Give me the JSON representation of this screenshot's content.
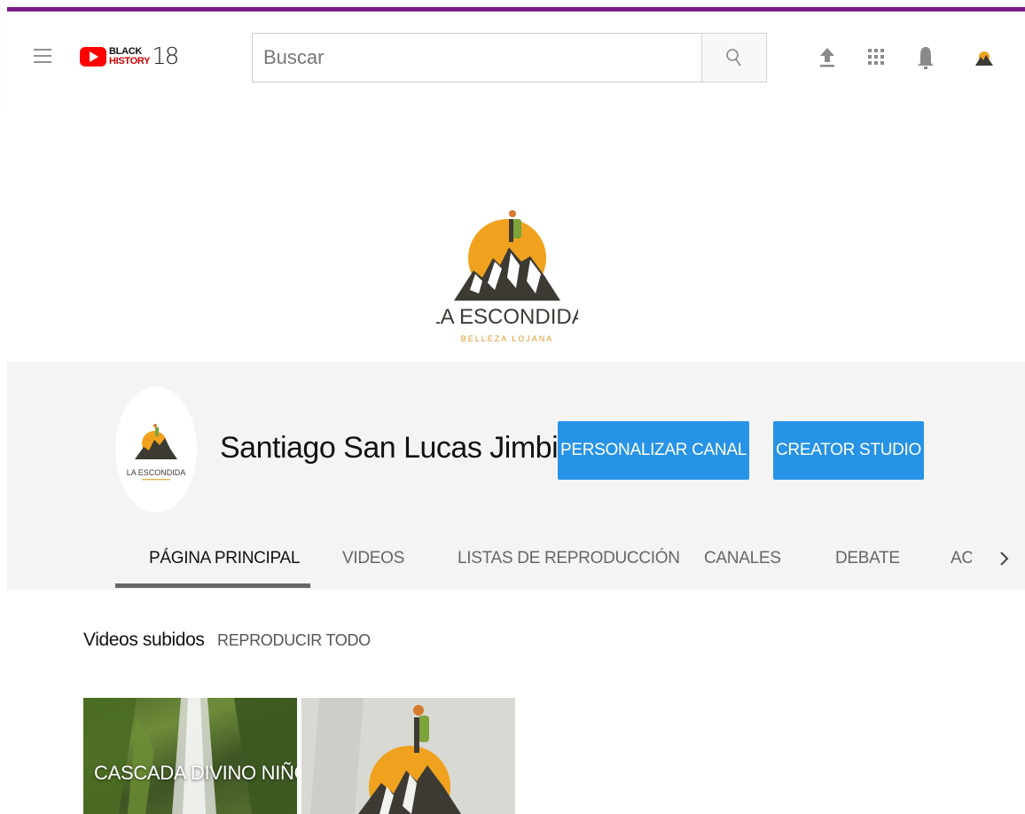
{
  "header": {
    "logo_line1": "BLACK",
    "logo_line2": "HISTORY",
    "logo_year": "18",
    "search_placeholder": "Buscar"
  },
  "banner": {
    "brand_name": "LA ESCONDIDA",
    "brand_tagline": "BELLEZA LOJANA"
  },
  "channel": {
    "name": "Santiago San Lucas Jimbilla",
    "avatar_brand": "LA ESCONDIDA",
    "customize_label": "PERSONALIZAR CANAL",
    "creator_studio_label": "CREATOR STUDIO"
  },
  "tabs": [
    {
      "label": "PÁGINA PRINCIPAL"
    },
    {
      "label": "VIDEOS"
    },
    {
      "label": "LISTAS DE REPRODUCCIÓN"
    },
    {
      "label": "CANALES"
    },
    {
      "label": "DEBATE"
    },
    {
      "label": "ACERCA DE"
    }
  ],
  "uploads": {
    "title": "Videos subidos",
    "play_all_label": "REPRODUCIR TODO",
    "videos": [
      {
        "caption": "CASCADA DIVINO NIÑO"
      },
      {
        "caption": ""
      }
    ]
  },
  "colors": {
    "accent_blue": "#2793e6",
    "top_strip": "#7b1b86",
    "brand_orange": "#f0a21e",
    "brand_dark": "#3d3a34"
  },
  "icons": [
    "menu-icon",
    "youtube-logo",
    "search-icon",
    "upload-icon",
    "apps-icon",
    "notifications-icon",
    "account-avatar",
    "chevron-right-icon"
  ]
}
